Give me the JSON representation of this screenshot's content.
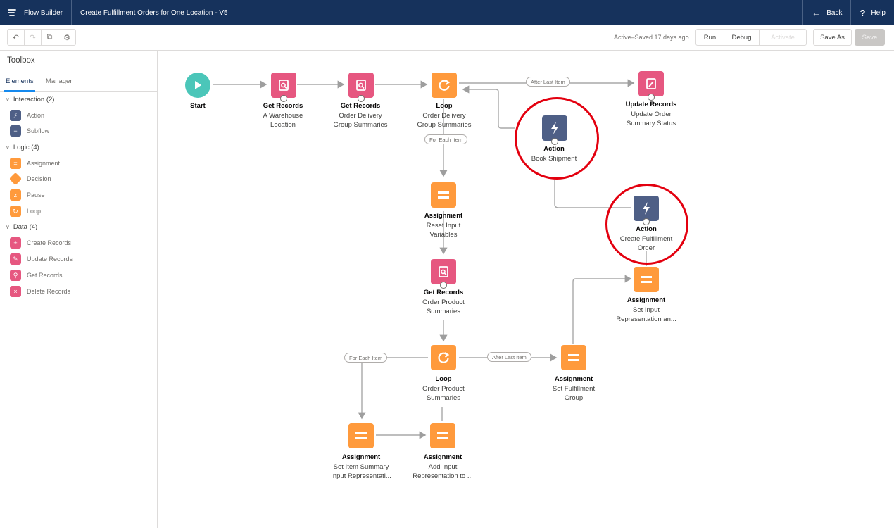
{
  "header": {
    "app_name": "Flow Builder",
    "flow_title": "Create Fulfillment Orders for One Location - V5",
    "back_label": "Back",
    "help_label": "Help"
  },
  "toolbar": {
    "status": "Active–Saved 17 days ago",
    "run_label": "Run",
    "debug_label": "Debug",
    "activate_label": "Activate",
    "save_as_label": "Save As",
    "save_label": "Save"
  },
  "toolbox": {
    "title": "Toolbox",
    "tabs": [
      "Elements",
      "Manager"
    ],
    "groups": [
      {
        "label": "Interaction (2)",
        "items": [
          "Action",
          "Subflow"
        ]
      },
      {
        "label": "Logic (4)",
        "items": [
          "Assignment",
          "Decision",
          "Pause",
          "Loop"
        ]
      },
      {
        "label": "Data (4)",
        "items": [
          "Create Records",
          "Update Records",
          "Get Records",
          "Delete Records"
        ]
      }
    ]
  },
  "flow": {
    "start": {
      "title": "Start"
    },
    "get_warehouse": {
      "title": "Get Records",
      "sub1": "A Warehouse",
      "sub2": "Location"
    },
    "get_delivery": {
      "title": "Get Records",
      "sub1": "Order Delivery",
      "sub2": "Group Summaries"
    },
    "loop_delivery": {
      "title": "Loop",
      "sub1": "Order Delivery",
      "sub2": "Group Summaries"
    },
    "update_records": {
      "title": "Update Records",
      "sub1": "Update Order",
      "sub2": "Summary Status"
    },
    "action_book": {
      "title": "Action",
      "sub1": "Book Shipment"
    },
    "action_create": {
      "title": "Action",
      "sub1": "Create Fulfillment",
      "sub2": "Order"
    },
    "assign_reset": {
      "title": "Assignment",
      "sub1": "Reset Input",
      "sub2": "Variables"
    },
    "get_product": {
      "title": "Get Records",
      "sub1": "Order Product",
      "sub2": "Summaries"
    },
    "assign_set_input": {
      "title": "Assignment",
      "sub1": "Set Input",
      "sub2": "Representation an..."
    },
    "loop_product": {
      "title": "Loop",
      "sub1": "Order Product",
      "sub2": "Summaries"
    },
    "assign_set_group": {
      "title": "Assignment",
      "sub1": "Set Fulfillment",
      "sub2": "Group"
    },
    "assign_set_item": {
      "title": "Assignment",
      "sub1": "Set Item Summary",
      "sub2": "Input Representati..."
    },
    "assign_add_input": {
      "title": "Assignment",
      "sub1": "Add Input",
      "sub2": "Representation to ..."
    },
    "connectors": {
      "after_last_item_1": "After Last Item",
      "for_each_item_1": "For Each Item",
      "for_each_item_2": "For Each Item",
      "after_last_item_2": "After Last Item"
    }
  },
  "colors": {
    "header_bg": "#16325c",
    "start": "#4bc6b9",
    "records": "#e65780",
    "logic": "#ff9a3c",
    "action": "#4e5f86",
    "highlight_circle": "#e3000f"
  }
}
